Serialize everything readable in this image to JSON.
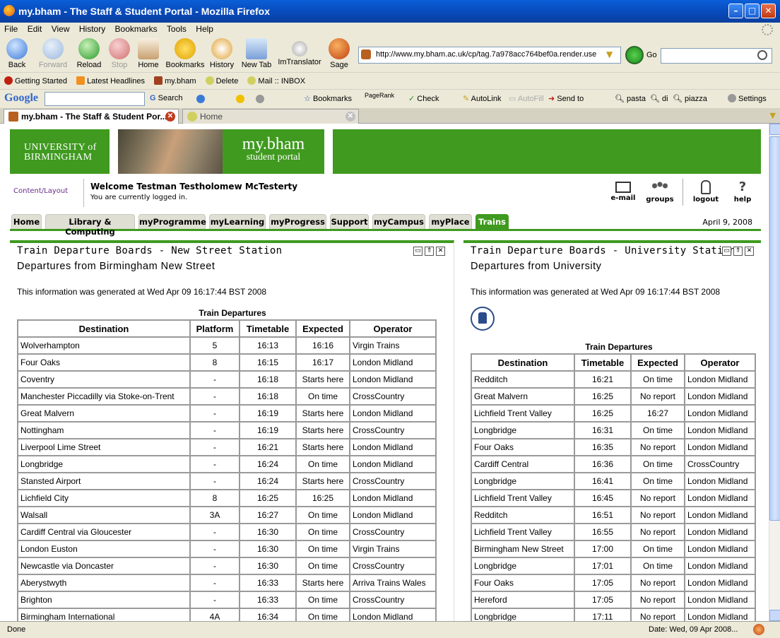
{
  "window": {
    "title": "my.bham - The Staff & Student Portal - Mozilla Firefox"
  },
  "menu": [
    "File",
    "Edit",
    "View",
    "History",
    "Bookmarks",
    "Tools",
    "Help"
  ],
  "nav": {
    "back": "Back",
    "forward": "Forward",
    "reload": "Reload",
    "stop": "Stop",
    "home": "Home",
    "bookmarks": "Bookmarks",
    "history": "History",
    "newtab": "New Tab",
    "imtranslator": "ImTranslator",
    "sage": "Sage",
    "url": "http://www.my.bham.ac.uk/cp/tag.7a978acc764bef0a.render.use",
    "go": "Go"
  },
  "bookmarks": [
    "Getting Started",
    "Latest Headlines",
    "my.bham",
    "Delete",
    "Mail :: INBOX"
  ],
  "google_bar": {
    "logo": "Google",
    "search": "Search",
    "bookmarks": "Bookmarks",
    "pagerank": "PageRank",
    "check": "Check",
    "autolink": "AutoLink",
    "autofill": "AutoFill",
    "sendto": "Send to",
    "t1": "pasta",
    "t2": "di",
    "t3": "piazza",
    "settings": "Settings"
  },
  "tabs": [
    {
      "label": "my.bham - The Staff & Student Por..."
    },
    {
      "label": "Home"
    }
  ],
  "portal": {
    "uni_line1": "UNIVERSITY of",
    "uni_line2": "BIRMINGHAM",
    "brand": "my.bham",
    "brand_sub": "student portal",
    "content_layout": "Content/Layout",
    "welcome": "Welcome Testman Testholomew McTesterty",
    "logged_in": "You are currently logged in.",
    "links": {
      "email": "e-mail",
      "groups": "groups",
      "logout": "logout",
      "help": "help"
    },
    "tabs": [
      "Home",
      "Library & Computing",
      "myProgramme",
      "myLearning",
      "myProgress",
      "Support",
      "myCampus",
      "myPlace",
      "Trains"
    ],
    "date": "April 9, 2008"
  },
  "ns": {
    "title": "Train Departure Boards - New Street Station",
    "subtitle": "Departures from Birmingham New Street",
    "generated": "This information was generated at Wed Apr 09 16:17:44 BST 2008",
    "caption": "Train Departures",
    "headers": [
      "Destination",
      "Platform",
      "Timetable",
      "Expected",
      "Operator"
    ],
    "rows": [
      [
        "Wolverhampton",
        "5",
        "16:13",
        "16:16",
        "Virgin Trains"
      ],
      [
        "Four Oaks",
        "8",
        "16:15",
        "16:17",
        "London Midland"
      ],
      [
        "Coventry",
        "-",
        "16:18",
        "Starts here",
        "London Midland"
      ],
      [
        "Manchester Piccadilly via Stoke-on-Trent",
        "-",
        "16:18",
        "On time",
        "CrossCountry"
      ],
      [
        "Great Malvern",
        "-",
        "16:19",
        "Starts here",
        "London Midland"
      ],
      [
        "Nottingham",
        "-",
        "16:19",
        "Starts here",
        "CrossCountry"
      ],
      [
        "Liverpool Lime Street",
        "-",
        "16:21",
        "Starts here",
        "London Midland"
      ],
      [
        "Longbridge",
        "-",
        "16:24",
        "On time",
        "London Midland"
      ],
      [
        "Stansted Airport",
        "-",
        "16:24",
        "Starts here",
        "CrossCountry"
      ],
      [
        "Lichfield City",
        "8",
        "16:25",
        "16:25",
        "London Midland"
      ],
      [
        "Walsall",
        "3A",
        "16:27",
        "On time",
        "London Midland"
      ],
      [
        "Cardiff Central via Gloucester",
        "-",
        "16:30",
        "On time",
        "CrossCountry"
      ],
      [
        "London Euston",
        "-",
        "16:30",
        "On time",
        "Virgin Trains"
      ],
      [
        "Newcastle via Doncaster",
        "-",
        "16:30",
        "On time",
        "CrossCountry"
      ],
      [
        "Aberystwyth",
        "-",
        "16:33",
        "Starts here",
        "Arriva Trains Wales"
      ],
      [
        "Brighton",
        "-",
        "16:33",
        "On time",
        "CrossCountry"
      ],
      [
        "Birmingham International",
        "4A",
        "16:34",
        "On time",
        "London Midland"
      ]
    ]
  },
  "uni": {
    "title": "Train Departure Boards - University Station",
    "subtitle": "Departures from University",
    "generated": "This information was generated at Wed Apr 09 16:17:44 BST 2008",
    "caption": "Train Departures",
    "headers": [
      "Destination",
      "Timetable",
      "Expected",
      "Operator"
    ],
    "rows": [
      [
        "Redditch",
        "16:21",
        "On time",
        "London Midland"
      ],
      [
        "Great Malvern",
        "16:25",
        "No report",
        "London Midland"
      ],
      [
        "Lichfield Trent Valley",
        "16:25",
        "16:27",
        "London Midland"
      ],
      [
        "Longbridge",
        "16:31",
        "On time",
        "London Midland"
      ],
      [
        "Four Oaks",
        "16:35",
        "No report",
        "London Midland"
      ],
      [
        "Cardiff Central",
        "16:36",
        "On time",
        "CrossCountry"
      ],
      [
        "Longbridge",
        "16:41",
        "On time",
        "London Midland"
      ],
      [
        "Lichfield Trent Valley",
        "16:45",
        "No report",
        "London Midland"
      ],
      [
        "Redditch",
        "16:51",
        "No report",
        "London Midland"
      ],
      [
        "Lichfield Trent Valley",
        "16:55",
        "No report",
        "London Midland"
      ],
      [
        "Birmingham New Street",
        "17:00",
        "On time",
        "London Midland"
      ],
      [
        "Longbridge",
        "17:01",
        "On time",
        "London Midland"
      ],
      [
        "Four Oaks",
        "17:05",
        "No report",
        "London Midland"
      ],
      [
        "Hereford",
        "17:05",
        "No report",
        "London Midland"
      ],
      [
        "Longbridge",
        "17:11",
        "No report",
        "London Midland"
      ]
    ]
  },
  "status": {
    "left": "Done",
    "right": "Date: Wed, 09 Apr 2008..."
  }
}
